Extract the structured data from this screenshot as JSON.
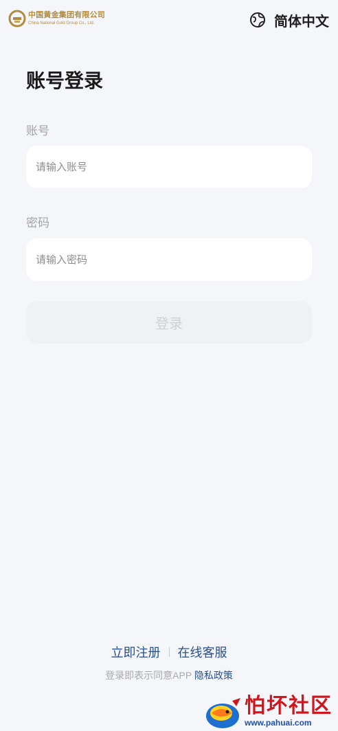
{
  "header": {
    "logo": {
      "name_cn": "中国黄金集团有限公司",
      "name_en": "China National Gold Group Co., Ltd.",
      "icon": "gold-emblem-icon"
    },
    "language": {
      "label": "简体中文",
      "icon": "globe-icon"
    }
  },
  "login": {
    "title": "账号登录",
    "account_label": "账号",
    "account_placeholder": "请输入账号",
    "account_value": "",
    "password_label": "密码",
    "password_placeholder": "请输入密码",
    "password_value": "",
    "submit_label": "登录"
  },
  "footer": {
    "register_label": "立即注册",
    "support_label": "在线客服",
    "agreement_prefix": "登录即表示同意APP",
    "privacy_label": "隐私政策"
  },
  "watermark": {
    "text_cn": "怕坏社区",
    "url": "www.pahuai.com",
    "icon": "fish-logo-icon"
  },
  "colors": {
    "background": "#f5f6fa",
    "brand_gold": "#b08a3e",
    "link_blue": "#2b4f8c",
    "disabled_button": "#f0f1f5"
  }
}
